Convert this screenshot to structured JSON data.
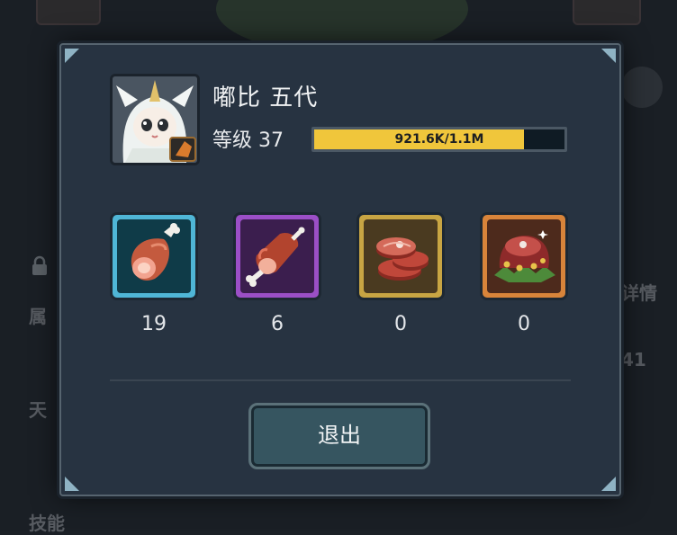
{
  "background": {
    "left_label_1": "属",
    "left_label_2": "天",
    "left_label_3": "技能",
    "right_label_1": "详情",
    "right_value_1": "41"
  },
  "dialog": {
    "character_name": "嘟比 五代",
    "level_label": "等级 37",
    "xp_text": "921.6K/1.1M",
    "xp_progress": 0.838,
    "exit_label": "退出"
  },
  "foods": [
    {
      "icon": "ham-leg-icon",
      "rarity": "blue",
      "count": "19"
    },
    {
      "icon": "roast-meat-icon",
      "rarity": "purple",
      "count": "6"
    },
    {
      "icon": "steak-slices-icon",
      "rarity": "gold",
      "count": "0"
    },
    {
      "icon": "feast-meat-icon",
      "rarity": "orange",
      "count": "0"
    }
  ],
  "colors": {
    "xp_fill": "#f0c63b",
    "rarity_blue": "#4fb6d6",
    "rarity_purple": "#9b4fc6",
    "rarity_gold": "#c8a543",
    "rarity_orange": "#d8843a"
  }
}
